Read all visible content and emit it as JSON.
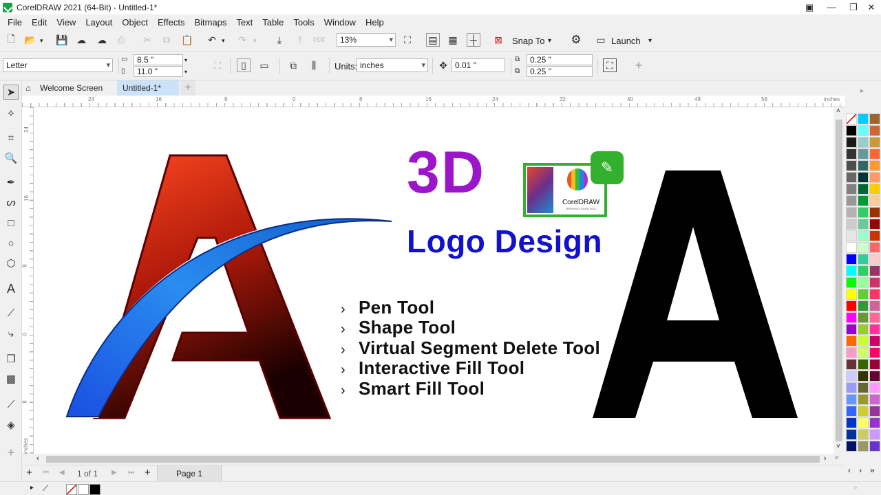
{
  "app": {
    "title": "CorelDRAW 2021 (64-Bit) - Untitled-1*"
  },
  "menu": [
    "File",
    "Edit",
    "View",
    "Layout",
    "Object",
    "Effects",
    "Bitmaps",
    "Text",
    "Table",
    "Tools",
    "Window",
    "Help"
  ],
  "toolbar": {
    "zoom": "13%",
    "snap_label": "Snap To",
    "launch_label": "Launch"
  },
  "property_bar": {
    "page_size": "Letter",
    "width": "8.5 \"",
    "height": "11.0 \"",
    "units_label": "Units:",
    "units": "inches",
    "nudge": "0.01 \"",
    "dup_x": "0.25 \"",
    "dup_y": "0.25 \""
  },
  "tabs": [
    {
      "label": "Welcome Screen"
    },
    {
      "label": "Untitled-1*"
    }
  ],
  "ruler": {
    "h_ticks": [
      "24",
      "16",
      "8",
      "0",
      "8",
      "16",
      "24",
      "32",
      "40",
      "48",
      "56"
    ],
    "unit": "inches",
    "v_ticks": [
      "24",
      "16",
      "8",
      "0",
      "8"
    ]
  },
  "canvas": {
    "headline": "3D",
    "subheadline": "Logo Design",
    "badge_text": "CorelDRAW",
    "badge_sub": "GRAPHICS SUITE 2021",
    "big_letter": "A",
    "logo_letter": "A",
    "bullets": [
      "Pen Tool",
      "Shape Tool",
      "Virtual Segment Delete Tool",
      "Interactive Fill Tool",
      "Smart Fill Tool"
    ]
  },
  "pagebar": {
    "counter": "1 of 1",
    "page_tab": "Page 1"
  },
  "colors": {
    "accent_purple": "#9b16c8",
    "accent_blue": "#1212cc",
    "logo_red": "#c8200e",
    "logo_blue": "#1a6ee6",
    "badge_green": "#33b02e"
  },
  "palette": {
    "col1": [
      "none",
      "#000000",
      "#1a1a1a",
      "#333333",
      "#4d4d4d",
      "#666666",
      "#808080",
      "#999999",
      "#b3b3b3",
      "#cccccc",
      "#e6e6e6",
      "#ffffff",
      "#0000ff",
      "#00ffff",
      "#00ff00",
      "#ffff00",
      "#ff0000",
      "#ff00ff",
      "#9900cc",
      "#ff6600",
      "#ff99cc",
      "#663333",
      "#ccccff",
      "#9999ff",
      "#6699ff",
      "#3366ff",
      "#0033cc",
      "#003399",
      "#001166"
    ],
    "col2": [
      "#00ccff",
      "#66ffff",
      "#99cccc",
      "#669999",
      "#336666",
      "#003333",
      "#006633",
      "#009933",
      "#33cc66",
      "#66cc99",
      "#99ffcc",
      "#ccffcc",
      "#33cc99",
      "#33cc66",
      "#99ff99",
      "#66cc33",
      "#339933",
      "#669933",
      "#99cc33",
      "#ccff33",
      "#ccff66",
      "#336600",
      "#333300",
      "#666633",
      "#999933",
      "#cccc33",
      "#ffff66",
      "#cccc66",
      "#999966"
    ],
    "col3": [
      "#996633",
      "#cc6633",
      "#cc9933",
      "#ff6633",
      "#ff9933",
      "#ff9966",
      "#ffcc00",
      "#ffcc99",
      "#993300",
      "#990000",
      "#cc3300",
      "#ff6666",
      "#ffcccc",
      "#993366",
      "#cc3366",
      "#ff3366",
      "#cc6699",
      "#ff6699",
      "#ff3399",
      "#cc0066",
      "#ff0066",
      "#990033",
      "#660033",
      "#ff99ff",
      "#cc66cc",
      "#993399",
      "#9933cc",
      "#cc99ff",
      "#6633cc"
    ]
  },
  "status": {}
}
